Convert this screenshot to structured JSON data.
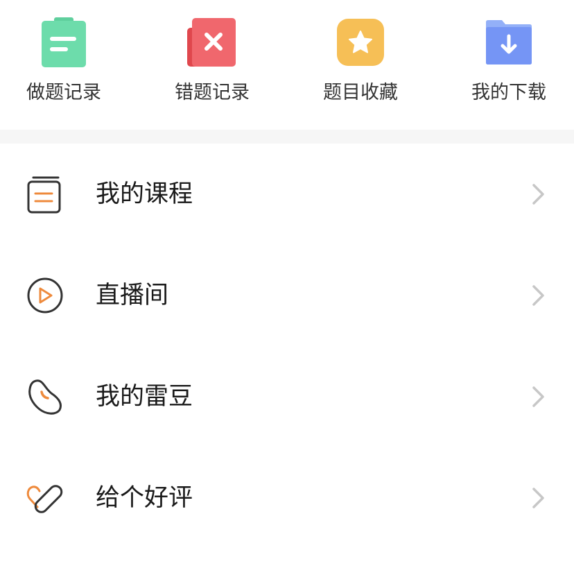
{
  "quick_actions": [
    {
      "label": "做题记录",
      "icon": "practice-record-icon",
      "color": "#6ddcab"
    },
    {
      "label": "错题记录",
      "icon": "wrong-answers-icon",
      "color": "#f0676d"
    },
    {
      "label": "题目收藏",
      "icon": "star-favorites-icon",
      "color": "#f6bf56"
    },
    {
      "label": "我的下载",
      "icon": "download-folder-icon",
      "color": "#7595f5"
    }
  ],
  "menu": [
    {
      "label": "我的课程",
      "icon": "course-book-icon"
    },
    {
      "label": "直播间",
      "icon": "live-play-icon"
    },
    {
      "label": "我的雷豆",
      "icon": "bean-icon"
    },
    {
      "label": "给个好评",
      "icon": "heart-rating-icon"
    }
  ],
  "colors": {
    "accent": "#ee8a3c",
    "icon_stroke": "#333333",
    "chevron": "#c7c7c7",
    "divider_band": "#f6f6f6"
  }
}
